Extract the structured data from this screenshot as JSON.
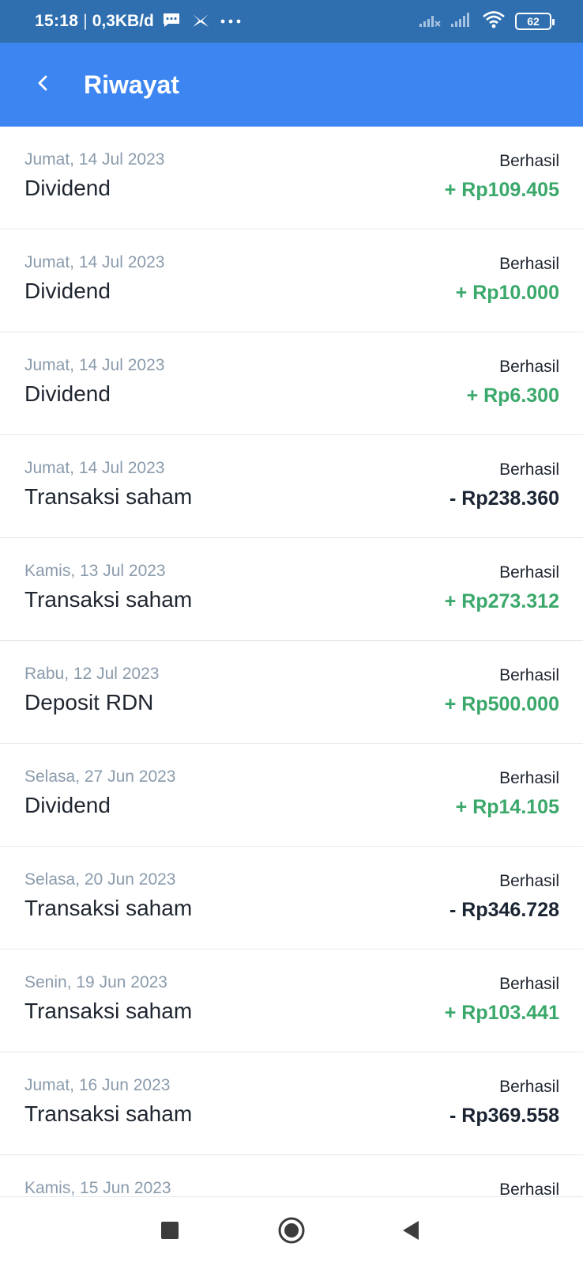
{
  "status_bar": {
    "time": "15:18",
    "separator": "|",
    "speed": "0,3KB/d",
    "battery": "62",
    "icons": [
      "message-icon",
      "network-icon",
      "more-icon",
      "signal-icon",
      "signal-icon",
      "wifi-icon",
      "battery-icon"
    ]
  },
  "header": {
    "title": "Riwayat",
    "back_icon": "back-arrow-icon"
  },
  "transactions": [
    {
      "date": "Jumat, 14 Jul 2023",
      "title": "Dividend",
      "status": "Berhasil",
      "amount": "+ Rp109.405",
      "direction": "in"
    },
    {
      "date": "Jumat, 14 Jul 2023",
      "title": "Dividend",
      "status": "Berhasil",
      "amount": "+ Rp10.000",
      "direction": "in"
    },
    {
      "date": "Jumat, 14 Jul 2023",
      "title": "Dividend",
      "status": "Berhasil",
      "amount": "+ Rp6.300",
      "direction": "in"
    },
    {
      "date": "Jumat, 14 Jul 2023",
      "title": "Transaksi saham",
      "status": "Berhasil",
      "amount": "- Rp238.360",
      "direction": "out"
    },
    {
      "date": "Kamis, 13 Jul 2023",
      "title": "Transaksi saham",
      "status": "Berhasil",
      "amount": "+ Rp273.312",
      "direction": "in"
    },
    {
      "date": "Rabu, 12 Jul 2023",
      "title": "Deposit RDN",
      "status": "Berhasil",
      "amount": "+ Rp500.000",
      "direction": "in"
    },
    {
      "date": "Selasa, 27 Jun 2023",
      "title": "Dividend",
      "status": "Berhasil",
      "amount": "+ Rp14.105",
      "direction": "in"
    },
    {
      "date": "Selasa, 20 Jun 2023",
      "title": "Transaksi saham",
      "status": "Berhasil",
      "amount": "- Rp346.728",
      "direction": "out"
    },
    {
      "date": "Senin, 19 Jun 2023",
      "title": "Transaksi saham",
      "status": "Berhasil",
      "amount": "+ Rp103.441",
      "direction": "in"
    },
    {
      "date": "Jumat, 16 Jun 2023",
      "title": "Transaksi saham",
      "status": "Berhasil",
      "amount": "- Rp369.558",
      "direction": "out"
    },
    {
      "date": "Kamis, 15 Jun 2023",
      "title": "",
      "status": "Berhasil",
      "amount": "",
      "direction": "in"
    }
  ],
  "colors": {
    "status_bar": "#2f6fb0",
    "app_bar": "#3d86f2",
    "amount_in": "#3aa86a",
    "amount_out": "#1b2433",
    "date_text": "#8a9bac"
  },
  "nav": {
    "icons": [
      "recents-square-icon",
      "home-circle-icon",
      "back-triangle-icon"
    ]
  }
}
